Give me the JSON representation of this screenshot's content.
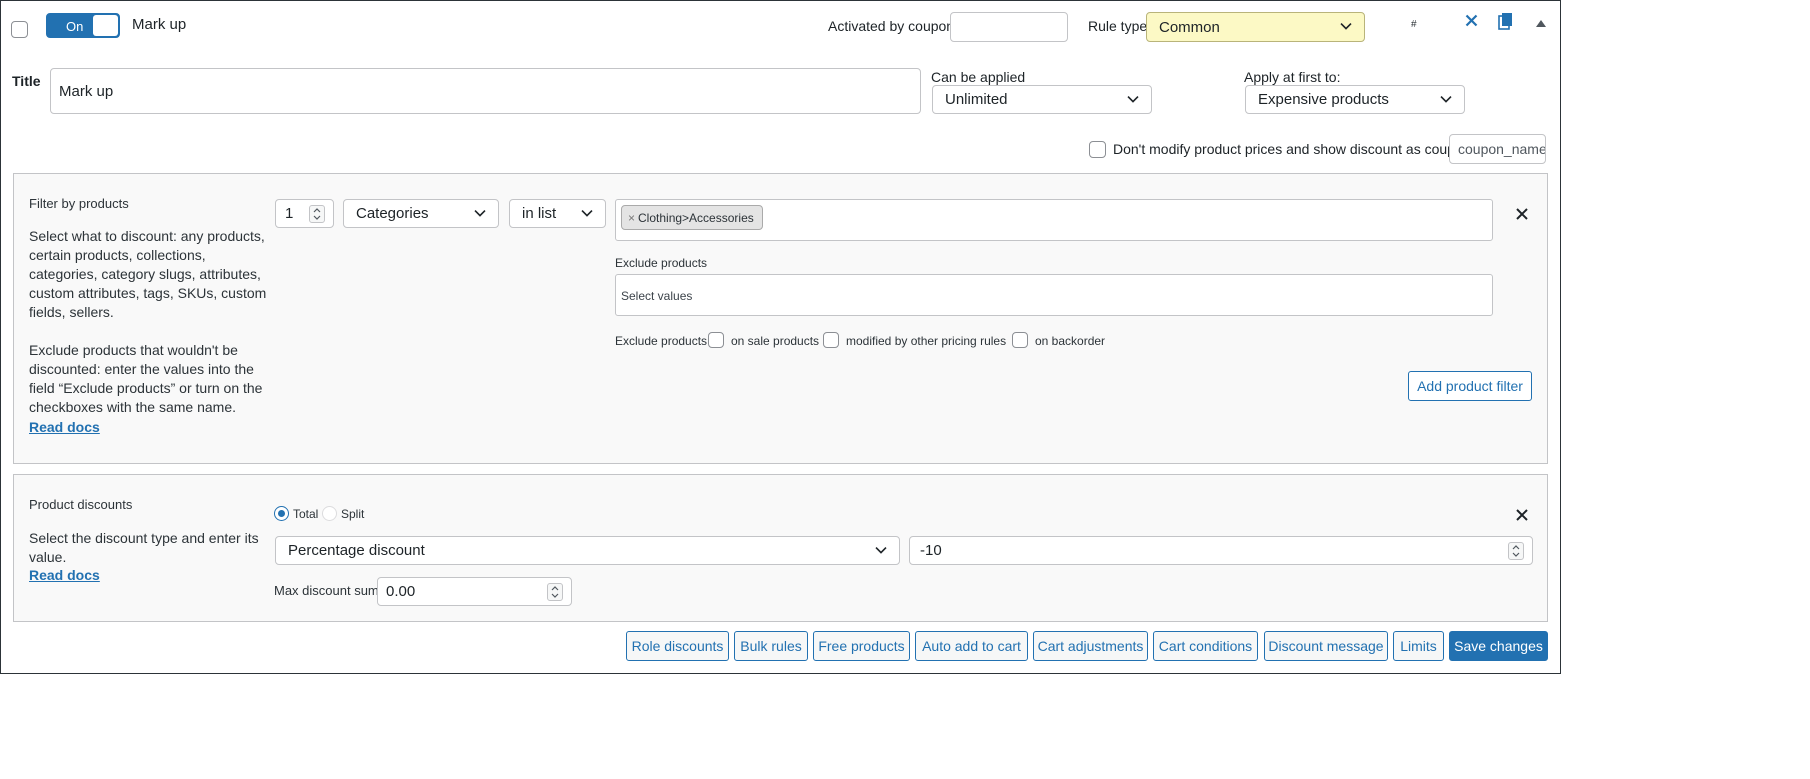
{
  "header": {
    "toggle_label": "On",
    "rule_name": "Mark up",
    "activated_by_coupon_label": "Activated by coupon",
    "activated_by_coupon_value": "",
    "rule_type_label": "Rule type",
    "rule_type_value": "Common",
    "hash_label": "#"
  },
  "title_row": {
    "title_label": "Title",
    "title_value": "Mark up",
    "can_be_applied_label": "Can be applied",
    "can_be_applied_value": "Unlimited",
    "apply_first_label": "Apply at first to:",
    "apply_first_value": "Expensive products"
  },
  "coupon_row": {
    "checkbox_label": "Don't modify product prices and show discount as coupon",
    "coupon_name_value": "coupon_name"
  },
  "filter_panel": {
    "title": "Filter by products",
    "desc1_lines": [
      "Select what to discount: any products,",
      "certain products, collections,",
      "categories, category slugs, attributes,",
      "custom attributes, tags, SKUs, custom",
      "fields, sellers."
    ],
    "desc2_lines": [
      "Exclude products that wouldn't be",
      "discounted: enter the values into the",
      "field “Exclude products” or turn on the",
      "checkboxes with the same name."
    ],
    "read_docs": "Read docs",
    "qty_value": "1",
    "filter_type_value": "Categories",
    "condition_value": "in list",
    "tag_remove": "×",
    "tag_label": "Clothing>Accessories",
    "exclude_label": "Exclude products",
    "exclude_placeholder": "Select values",
    "exclude_checks_label": "Exclude products",
    "check_on_sale": "on sale products",
    "check_modified": "modified by other pricing rules",
    "check_backorder": "on backorder",
    "add_filter_button": "Add product filter"
  },
  "discount_panel": {
    "title": "Product discounts",
    "desc_lines": [
      "Select the discount type and enter its",
      "value."
    ],
    "read_docs": "Read docs",
    "radio_total": "Total",
    "radio_split": "Split",
    "discount_type_value": "Percentage discount",
    "discount_value": "-10",
    "max_sum_label": "Max discount sum:",
    "max_sum_value": "0.00"
  },
  "footer_buttons": [
    "Role discounts",
    "Bulk rules",
    "Free products",
    "Auto add to cart",
    "Cart adjustments",
    "Cart conditions",
    "Discount message",
    "Limits"
  ],
  "save_button": "Save changes",
  "colors": {
    "accent": "#2271b1",
    "rule_type_bg": "#fcf9c5",
    "tag_bg": "#e4e4e4"
  }
}
